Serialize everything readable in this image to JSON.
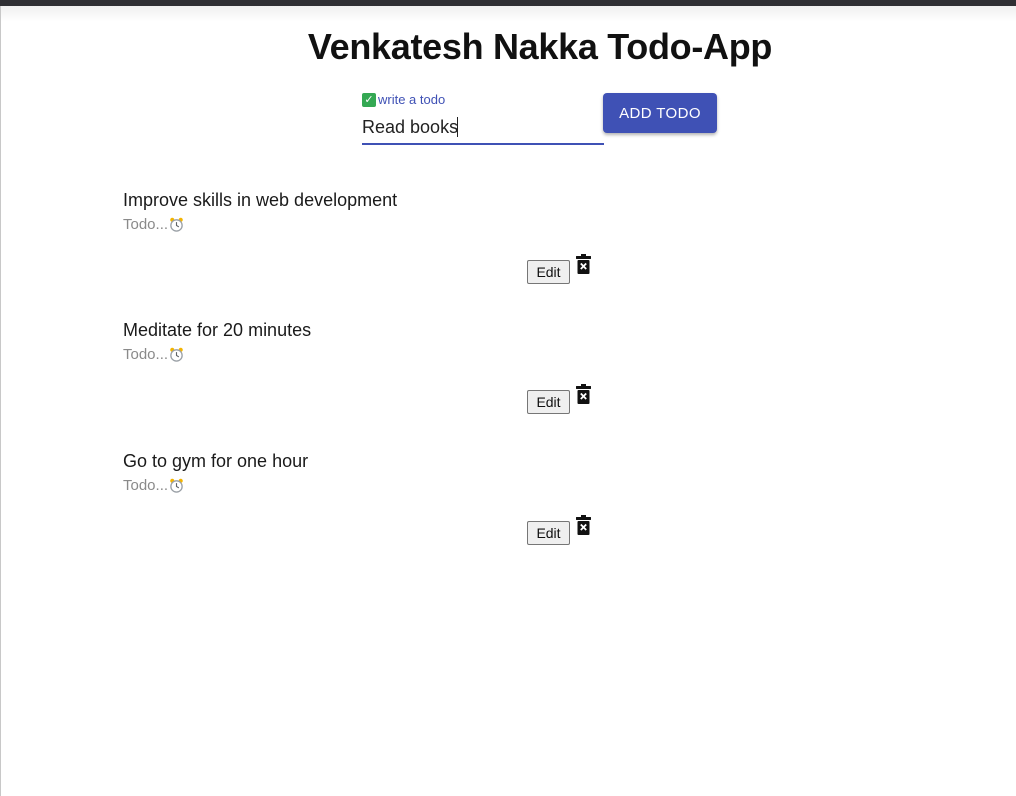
{
  "app": {
    "title": "Venkatesh Nakka Todo-App"
  },
  "form": {
    "label": "write a todo",
    "input_value": "Read books",
    "add_button_label": "ADD TODO"
  },
  "todos": [
    {
      "text": "Improve skills in web development",
      "status": "Todo...",
      "edit_label": "Edit"
    },
    {
      "text": "Meditate for 20 minutes",
      "status": "Todo...",
      "edit_label": "Edit"
    },
    {
      "text": "Go to gym for one hour",
      "status": "Todo...",
      "edit_label": "Edit"
    }
  ],
  "colors": {
    "primary": "#3f51b5",
    "check_green": "#34a853",
    "status_gray": "#8a8a8a"
  },
  "icons": {
    "label_icon": "check-mark-icon",
    "status_icon": "alarm-clock-icon",
    "delete_icon": "trash-icon"
  }
}
